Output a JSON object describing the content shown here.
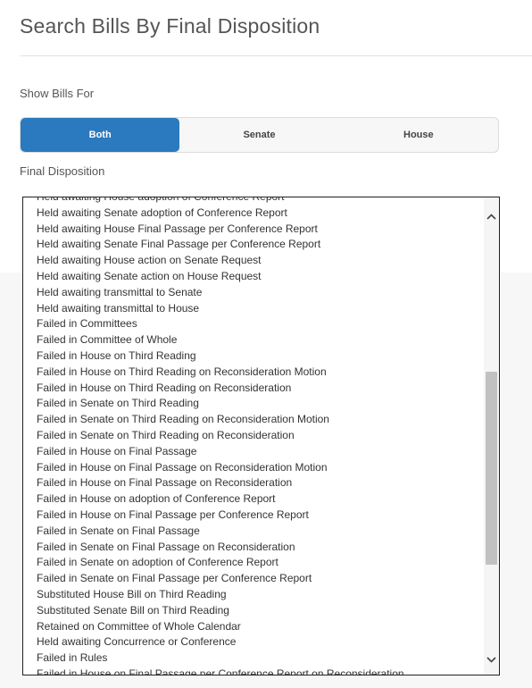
{
  "page": {
    "title": "Search Bills By Final Disposition"
  },
  "show_bills_for": {
    "label": "Show Bills For",
    "options": [
      "Both",
      "Senate",
      "House"
    ],
    "selected": "Both"
  },
  "final_disposition": {
    "label": "Final Disposition",
    "options": [
      "Held awaiting House adoption of Conference Report",
      "Held awaiting Senate adoption of Conference Report",
      "Held awaiting House Final Passage per Conference Report",
      "Held awaiting Senate Final Passage per Conference Report",
      "Held awaiting House action on Senate Request",
      "Held awaiting Senate action on House Request",
      "Held awaiting transmittal to Senate",
      "Held awaiting transmittal to House",
      "Failed in Committees",
      "Failed in Committee of Whole",
      "Failed in House on Third Reading",
      "Failed in House on Third Reading on Reconsideration Motion",
      "Failed in House on Third Reading on Reconsideration",
      "Failed in Senate on Third Reading",
      "Failed in Senate on Third Reading on Reconsideration Motion",
      "Failed in Senate on Third Reading on Reconsideration",
      "Failed in House on Final Passage",
      "Failed in House on Final Passage on Reconsideration Motion",
      "Failed in House on Final Passage on Reconsideration",
      "Failed in House on adoption of Conference Report",
      "Failed in House on Final Passage per Conference Report",
      "Failed in Senate on Final Passage",
      "Failed in Senate on Final Passage on Reconsideration",
      "Failed in Senate on adoption of Conference Report",
      "Failed in Senate on Final Passage per Conference Report",
      "Substituted House Bill on Third Reading",
      "Substituted Senate Bill on Third Reading",
      "Retained on Committee of Whole Calendar",
      "Held awaiting Concurrence or Conference",
      "Failed in Rules",
      "Failed in House on Final Passage per Conference Report on Reconsideration"
    ]
  },
  "icons": {
    "scroll_up": "chevron-up-icon",
    "scroll_down": "chevron-down-icon"
  },
  "colors": {
    "accent": "#2b79be",
    "panel": "#ffffff",
    "background": "#f7f7f7"
  }
}
